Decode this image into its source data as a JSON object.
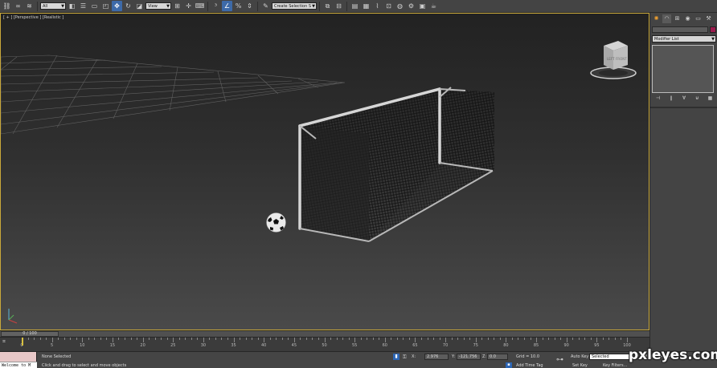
{
  "toolbar": {
    "selection_filter": "All",
    "ref_coord": "View",
    "named_selection": "Create Selection S"
  },
  "viewport": {
    "label": "[ + ] [Perspective ] [Realistic ]"
  },
  "viewcube": {
    "face_left": "LEFT",
    "face_front": "FRONT"
  },
  "command_panel": {
    "modifier_list": "Modifier List",
    "object_color": "#9c1b4e"
  },
  "time_slider": {
    "position": "0 / 100"
  },
  "trackbar": {
    "ticks": [
      "0",
      "5",
      "10",
      "15",
      "20",
      "25",
      "30",
      "35",
      "40",
      "45",
      "50",
      "55",
      "60",
      "65",
      "70",
      "75",
      "80",
      "85",
      "90",
      "95",
      "100"
    ]
  },
  "status": {
    "maxscript": "Welcome to M",
    "selection": "None Selected",
    "prompt": "Click and drag to select and move objects",
    "x_label": "X:",
    "x_value": "2.976",
    "y_label": "Y:",
    "y_value": "-121.756",
    "z_label": "Z:",
    "z_value": "0.0",
    "grid": "Grid = 10.0",
    "add_time_tag": "Add Time Tag",
    "auto_key": "Auto Key",
    "set_key": "Set Key",
    "selected": "Selected",
    "key_filters": "Key Filters..."
  },
  "watermark": "pxleyes.com"
}
